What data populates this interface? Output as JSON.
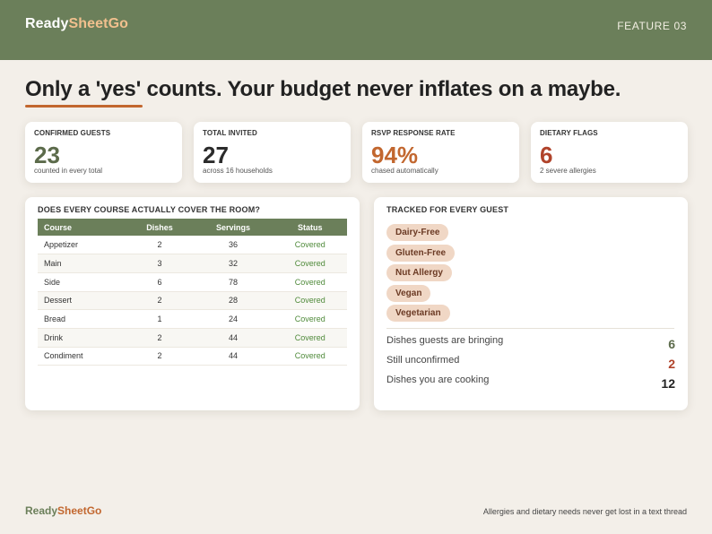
{
  "header": {
    "brand_part1": "Ready",
    "brand_part2": "SheetGo",
    "feature_label": "FEATURE 03"
  },
  "headline": "Only a 'yes' counts. Your budget never inflates on a maybe.",
  "stats": [
    {
      "label": "CONFIRMED GUESTS",
      "value": "23",
      "sub": "counted in every total",
      "color": "#5c6b4b"
    },
    {
      "label": "TOTAL INVITED",
      "value": "27",
      "sub": "across 16 households",
      "color": "#2b2b2b"
    },
    {
      "label": "RSVP RESPONSE RATE",
      "value": "94%",
      "sub": "chased automatically",
      "color": "#c2672f"
    },
    {
      "label": "DIETARY FLAGS",
      "value": "6",
      "sub": "2 severe allergies",
      "color": "#b0432b"
    }
  ],
  "coverage": {
    "title": "DOES EVERY COURSE ACTUALLY COVER THE ROOM?",
    "columns": [
      "Course",
      "Dishes",
      "Servings",
      "Status"
    ],
    "rows": [
      [
        "Appetizer",
        "2",
        "36",
        "Covered"
      ],
      [
        "Main",
        "3",
        "32",
        "Covered"
      ],
      [
        "Side",
        "6",
        "78",
        "Covered"
      ],
      [
        "Dessert",
        "2",
        "28",
        "Covered"
      ],
      [
        "Bread",
        "1",
        "24",
        "Covered"
      ],
      [
        "Drink",
        "2",
        "44",
        "Covered"
      ],
      [
        "Condiment",
        "2",
        "44",
        "Covered"
      ]
    ]
  },
  "tracked": {
    "title": "TRACKED FOR EVERY GUEST",
    "tags": [
      "Dairy-Free",
      "Gluten-Free",
      "Nut Allergy",
      "Vegan",
      "Vegetarian"
    ],
    "metrics": [
      {
        "label": "Dishes guests are bringing",
        "value": "6",
        "color": "#5c6b4b"
      },
      {
        "label": "Still unconfirmed",
        "value": "2",
        "color": "#b0432b"
      },
      {
        "label": "Dishes you are cooking",
        "value": "12",
        "color": "#222222"
      }
    ]
  },
  "footer": {
    "brand_part1": "Ready",
    "brand_part2": "SheetGo",
    "note": "Allergies and dietary needs never get lost in a text thread"
  },
  "colors": {
    "brand_green": "#6b7f5a",
    "accent_orange": "#c2672f",
    "covered_green": "#4f8a3a",
    "tag_bg": "#f0d7c5"
  }
}
